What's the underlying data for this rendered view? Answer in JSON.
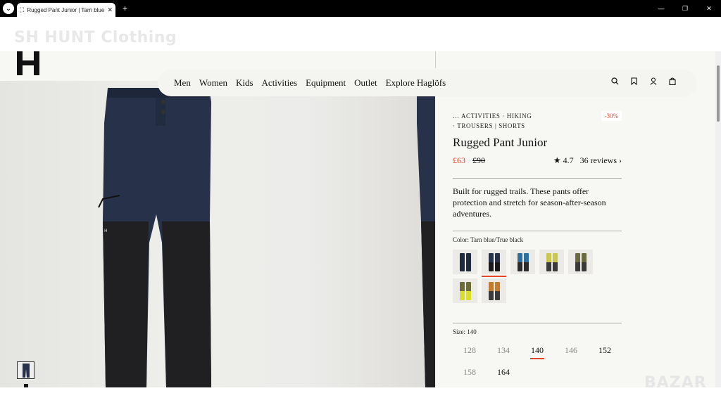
{
  "browser": {
    "tab_title": "Rugged Pant Junior | Tarn blue",
    "tab_favicon": "⛶",
    "tab_close": "✕",
    "new_tab": "+",
    "menu_icon": "⌄",
    "window_controls": [
      "—",
      "❐",
      "✕"
    ]
  },
  "overlay": {
    "watermark": "SH HUNT Clothing",
    "bottom_watermark": "BAZAR"
  },
  "nav": {
    "items": [
      "Men",
      "Women",
      "Kids",
      "Activities",
      "Equipment",
      "Outlet",
      "Explore Haglöfs"
    ],
    "icons": {
      "search": "⌕",
      "bookmark": "⚑",
      "account": "♙",
      "bag": "▣"
    }
  },
  "product": {
    "breadcrumb_line1": "… ACTIVITIES · HIKING",
    "breadcrumb_line2": "· TROUSERS  |  SHORTS",
    "discount": "-30%",
    "title": "Rugged Pant Junior",
    "price_now": "£63",
    "price_old": "£90",
    "rating": "★ 4.7",
    "reviews": "36 reviews ›",
    "description": "Built for rugged trails. These pants offer protection and stretch for season-after-season adventures.",
    "color_label": "Color: Tarn blue/True black",
    "swatches": [
      {
        "top": "#1f2a3c",
        "bottom": "#1f2a3c",
        "selected": false
      },
      {
        "top": "#26324a",
        "bottom": "#1a1a1a",
        "selected": true
      },
      {
        "top": "#2e6fa0",
        "bottom": "#2b2b2b",
        "selected": false
      },
      {
        "top": "#c9c84a",
        "bottom": "#3a3a3a",
        "selected": false
      },
      {
        "top": "#6a6a42",
        "bottom": "#3a3a3a",
        "selected": false
      },
      {
        "top": "#6e6d3a",
        "bottom": "#d8de2a",
        "selected": false
      },
      {
        "top": "#c47a2a",
        "bottom": "#3a3a3a",
        "selected": false
      }
    ],
    "size_label": "Size: 140",
    "sizes": [
      {
        "label": "128",
        "state": "unavailable"
      },
      {
        "label": "134",
        "state": "unavailable"
      },
      {
        "label": "140",
        "state": "selected"
      },
      {
        "label": "146",
        "state": "unavailable"
      },
      {
        "label": "152",
        "state": "available"
      },
      {
        "label": "158",
        "state": "unavailable"
      },
      {
        "label": "164",
        "state": "available"
      }
    ]
  }
}
